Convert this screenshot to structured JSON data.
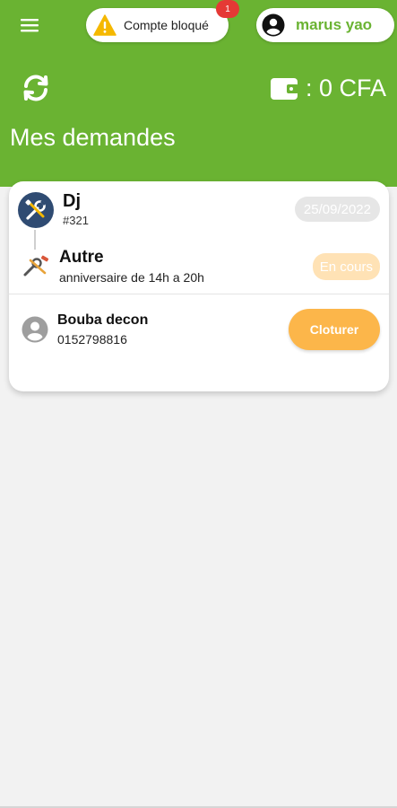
{
  "header": {
    "blocked_label": "Compte bloqué",
    "notification_count": "1",
    "user_name": "marus yao",
    "balance": ": 0 CFA",
    "page_title": "Mes demandes"
  },
  "request": {
    "service_name": "Dj",
    "request_id": "#321",
    "date": "25/09/2022",
    "category": "Autre",
    "description": "anniversaire de 14h a 20h",
    "status": "En cours",
    "provider_name": "Bouba decon",
    "provider_phone": "0152798816",
    "action_label": "Cloturer"
  },
  "icons": {
    "menu": "menu-icon",
    "warning": "warning-icon",
    "user": "user-icon",
    "refresh": "refresh-icon",
    "wallet": "wallet-icon",
    "service": "tools-icon",
    "category": "wrench-icon",
    "provider": "person-icon"
  },
  "colors": {
    "brand_green": "#6ab332",
    "accent_orange": "#fcb64a",
    "status_bg": "#ffe2b5",
    "notification_red": "#e53935",
    "avatar_blue": "#2f4b72"
  }
}
